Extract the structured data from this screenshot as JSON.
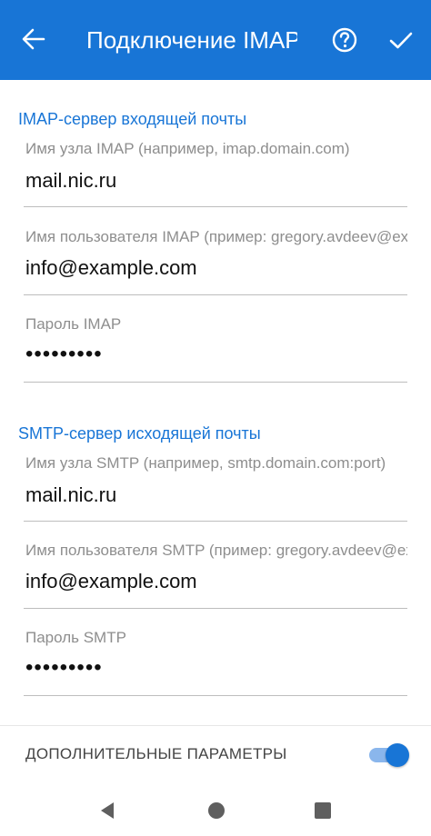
{
  "appbar": {
    "title": "Подключение IMAP",
    "back_icon": "arrow-left-icon",
    "help_icon": "help-circle-icon",
    "confirm_icon": "check-icon",
    "color": "#1875d6"
  },
  "imap": {
    "section_title": "IMAP-сервер входящей почты",
    "host": {
      "label": "Имя узла IMAP (например, imap.domain.com)",
      "value": "mail.nic.ru"
    },
    "username": {
      "label": "Имя пользователя IMAP (пример: gregory.avdeev@example.com)",
      "value": "info@example.com"
    },
    "password": {
      "label": "Пароль IMAP",
      "value": "•••••••••"
    }
  },
  "smtp": {
    "section_title": "SMTP-сервер исходящей почты",
    "host": {
      "label": "Имя узла SMTP (например, smtp.domain.com:port)",
      "value": "mail.nic.ru"
    },
    "username": {
      "label": "Имя пользователя SMTP (пример: gregory.avdeev@example.com)",
      "value": "info@example.com"
    },
    "password": {
      "label": "Пароль SMTP",
      "value": "•••••••••"
    }
  },
  "advanced": {
    "label": "ДОПОЛНИТЕЛЬНЫЕ ПАРАМЕТРЫ",
    "enabled": true
  },
  "navbar": {
    "back_icon": "triangle-back-icon",
    "home_icon": "circle-home-icon",
    "recents_icon": "square-recents-icon"
  }
}
